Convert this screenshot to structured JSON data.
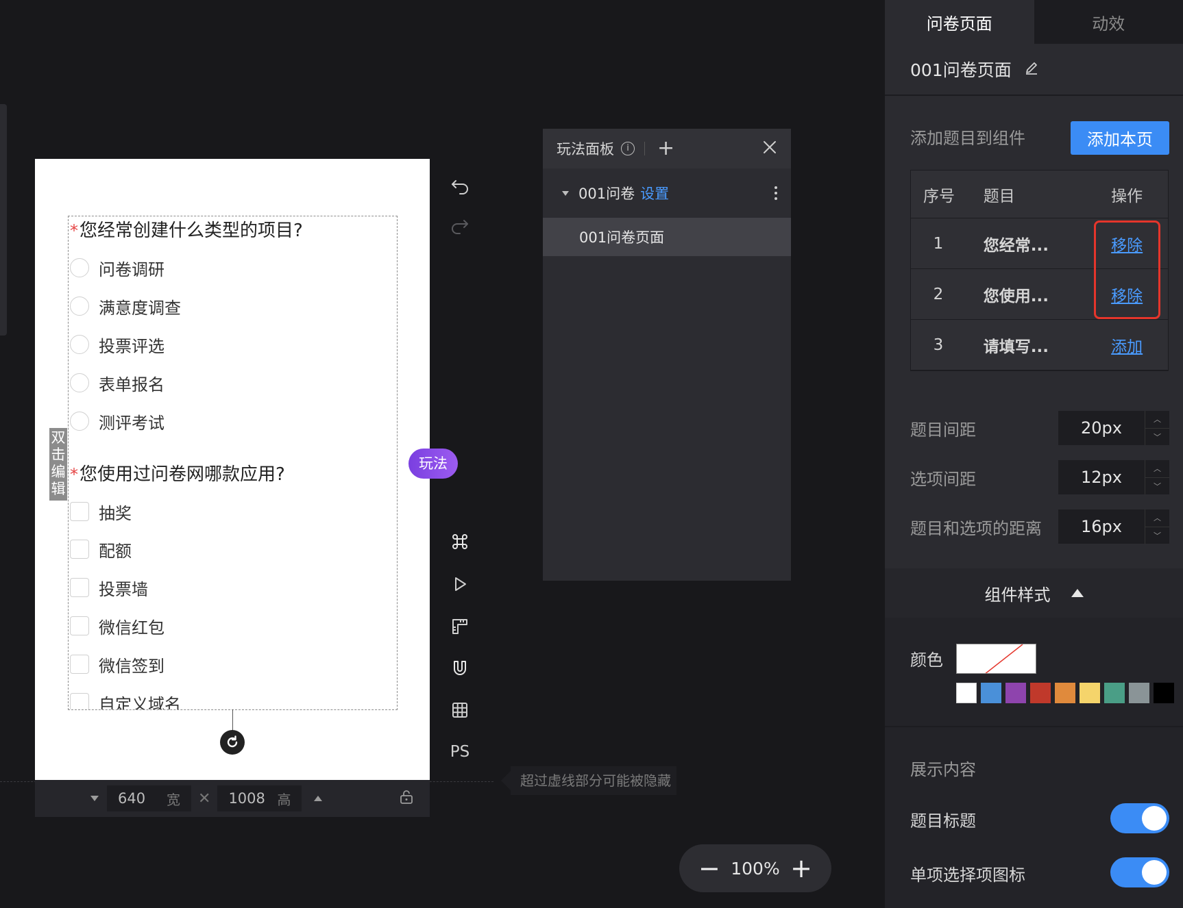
{
  "canvas": {
    "edit_hint": "双击编辑",
    "play_badge": "玩法",
    "width_value": "640",
    "width_unit": "宽",
    "height_value": "1008",
    "height_unit": "高",
    "hidden_hint": "超过虚线部分可能被隐藏",
    "tools_ps": "PS"
  },
  "questions": [
    {
      "required_mark": "*",
      "title": "您经常创建什么类型的项目?",
      "type": "radio",
      "options": [
        "问卷调研",
        "满意度调查",
        "投票评选",
        "表单报名",
        "测评考试"
      ]
    },
    {
      "required_mark": "*",
      "title": "您使用过问卷网哪款应用?",
      "type": "checkbox",
      "options": [
        "抽奖",
        "配额",
        "投票墙",
        "微信红包",
        "微信签到",
        "自定义域名"
      ]
    }
  ],
  "play_panel": {
    "title": "玩法面板",
    "tree_item": "001问卷",
    "tree_link": "设置",
    "page_item": "001问卷页面"
  },
  "zoom": {
    "minus": "−",
    "value": "100%",
    "plus": "+"
  },
  "right_panel": {
    "tabs": [
      "问卷页面",
      "动效"
    ],
    "page_name": "001问卷页面",
    "add_label": "添加题目到组件",
    "add_button": "添加本页",
    "table": {
      "headers": [
        "序号",
        "题目",
        "操作"
      ],
      "rows": [
        {
          "no": "1",
          "title": "您经常...",
          "action": "移除"
        },
        {
          "no": "2",
          "title": "您使用...",
          "action": "移除"
        },
        {
          "no": "3",
          "title": "请填写...",
          "action": "添加"
        }
      ]
    },
    "spacing": [
      {
        "label": "题目间距",
        "value": "20px"
      },
      {
        "label": "选项间距",
        "value": "12px"
      },
      {
        "label": "题目和选项的距离",
        "value": "16px"
      }
    ],
    "style_section": "组件样式",
    "color_label": "颜色",
    "palette": [
      "#ffffff",
      "#4a90d9",
      "#8e44ad",
      "#c0392b",
      "#e08a3c",
      "#f5d46b",
      "#4a9e86",
      "#8a9497",
      "#000000"
    ],
    "display_section": "展示内容",
    "toggles": [
      {
        "label": "题目标题",
        "on": true
      },
      {
        "label": "单项选择项图标",
        "on": true
      }
    ]
  }
}
